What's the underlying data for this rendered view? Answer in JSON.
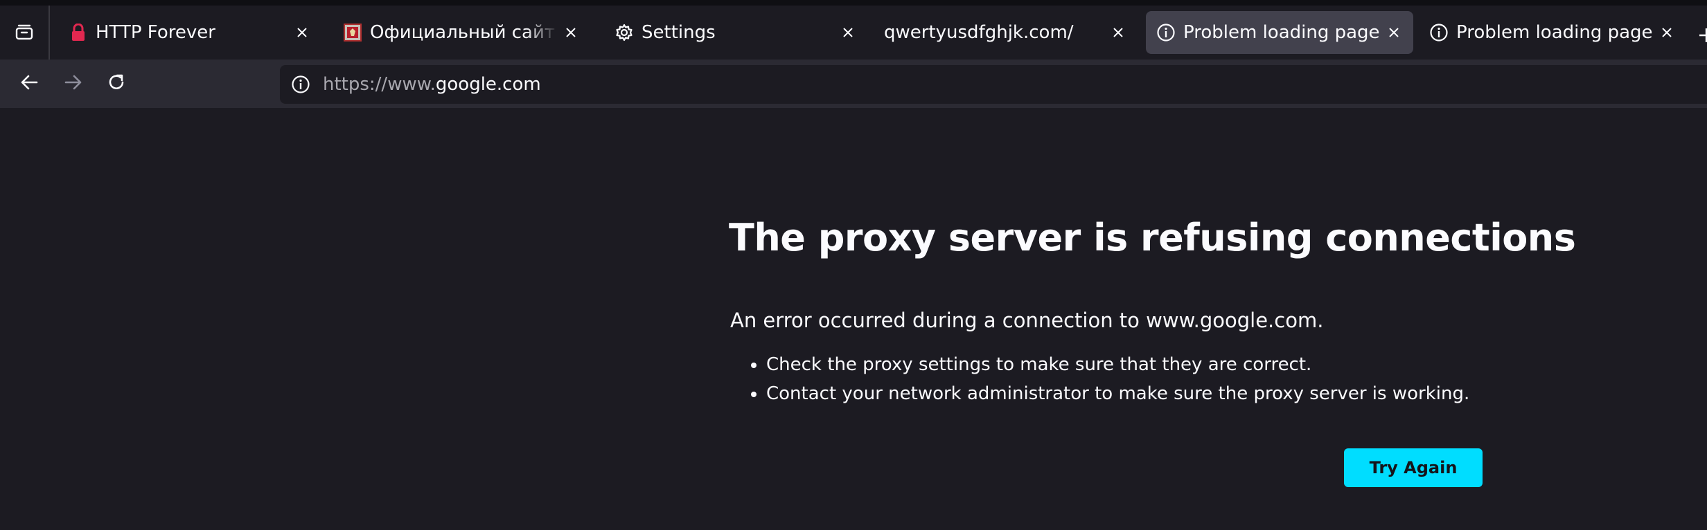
{
  "tabs": [
    {
      "title": "HTTP Forever",
      "icon": "lock-icon",
      "active": false
    },
    {
      "title": "Официальный сайт Адм",
      "icon": "site-favicon",
      "active": false
    },
    {
      "title": "Settings",
      "icon": "gear-icon",
      "active": false
    },
    {
      "title": "qwertyusdfghjk.com/",
      "icon": "none",
      "active": false
    },
    {
      "title": "Problem loading page",
      "icon": "info-icon",
      "active": true
    },
    {
      "title": "Problem loading page",
      "icon": "info-icon",
      "active": false
    }
  ],
  "urlbar": {
    "prefix": "https://www.",
    "domain": "google.com"
  },
  "error": {
    "title": "The proxy server is refusing connections",
    "description": "An error occurred during a connection to www.google.com.",
    "suggestions": [
      "Check the proxy settings to make sure that they are correct.",
      "Contact your network administrator to make sure the proxy server is working."
    ],
    "button_label": "Try Again"
  },
  "colors": {
    "accent": "#00ddff",
    "background": "#1c1b22",
    "toolbar": "#2b2a33",
    "active_tab": "#42414d",
    "lock_red": "#e22850"
  }
}
